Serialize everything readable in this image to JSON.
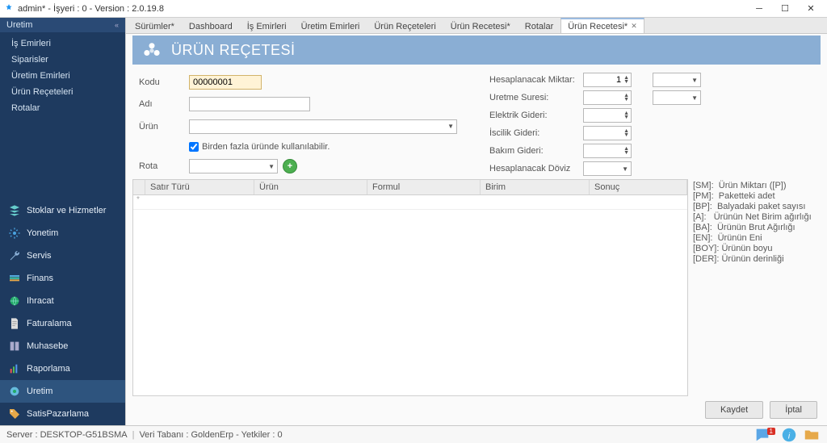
{
  "window": {
    "title": "admin* - İşyeri : 0 - Version : 2.0.19.8"
  },
  "sidebar": {
    "header": "Uretim",
    "sub_items": [
      "İş Emirleri",
      "Siparisler",
      "Üretim Emirleri",
      "Ürün Reçeteleri",
      "Rotalar"
    ],
    "main_items": [
      {
        "label": "Stoklar ve Hizmetler",
        "icon": "layers"
      },
      {
        "label": "Yonetim",
        "icon": "gear"
      },
      {
        "label": "Servis",
        "icon": "wrench"
      },
      {
        "label": "Finans",
        "icon": "stack"
      },
      {
        "label": "Ihracat",
        "icon": "globe"
      },
      {
        "label": "Faturalama",
        "icon": "doc"
      },
      {
        "label": "Muhasebe",
        "icon": "book"
      },
      {
        "label": "Raporlama",
        "icon": "chart"
      },
      {
        "label": "Uretim",
        "icon": "factory",
        "active": true
      },
      {
        "label": "SatisPazarlama",
        "icon": "tag"
      }
    ]
  },
  "tabs": [
    "Sürümler*",
    "Dashboard",
    "İş Emirleri",
    "Üretim Emirleri",
    "Ürün Reçeteleri",
    "Ürün Recetesi*",
    "Rotalar",
    "Ürün Recetesi*"
  ],
  "active_tab_index": 7,
  "banner": {
    "title": "ÜRÜN REÇETESİ"
  },
  "form": {
    "left": {
      "kodu_label": "Kodu",
      "kodu_value": "00000001",
      "adi_label": "Adı",
      "adi_value": "",
      "urun_label": "Ürün",
      "urun_value": "",
      "multi_label": "Birden fazla üründe kullanılabilir.",
      "rota_label": "Rota",
      "rota_value": ""
    },
    "right": {
      "hesap_miktar_label": "Hesaplanacak Miktar:",
      "hesap_miktar_value": "1",
      "uretme_suresi_label": "Uretme Suresi:",
      "elektrik_label": "Elektrik Gideri:",
      "iscilik_label": "İscilik Gideri:",
      "bakim_label": "Bakım Gideri:",
      "doviz_label": "Hesaplanacak Döviz"
    }
  },
  "grid": {
    "columns": [
      "Satır Türü",
      "Ürün",
      "Formul",
      "Birim",
      "Sonuç"
    ]
  },
  "legend": [
    {
      "k": "[SM]:",
      "v": "Ürün Miktarı ([P])"
    },
    {
      "k": "[PM]:",
      "v": "Paketteki adet"
    },
    {
      "k": "[BP]:",
      "v": "Balyadaki paket sayısı"
    },
    {
      "k": "[A]:",
      "v": "Ürünün Net Birim ağırlığı"
    },
    {
      "k": "[BA]:",
      "v": "Ürünün Brut Ağırlığı"
    },
    {
      "k": "[EN]:",
      "v": "Ürünün Eni"
    },
    {
      "k": "[BOY]:",
      "v": "Ürünün boyu"
    },
    {
      "k": "[DER]:",
      "v": "Ürünün derinliği"
    }
  ],
  "buttons": {
    "save": "Kaydet",
    "cancel": "İptal"
  },
  "status": {
    "server_label": "Server :",
    "server": "DESKTOP-G51BSMA",
    "db_label": "Veri Tabanı :",
    "db": "GoldenErp",
    "auth_label": "- Yetkiler :",
    "auth": "0",
    "notif_count": "1"
  }
}
